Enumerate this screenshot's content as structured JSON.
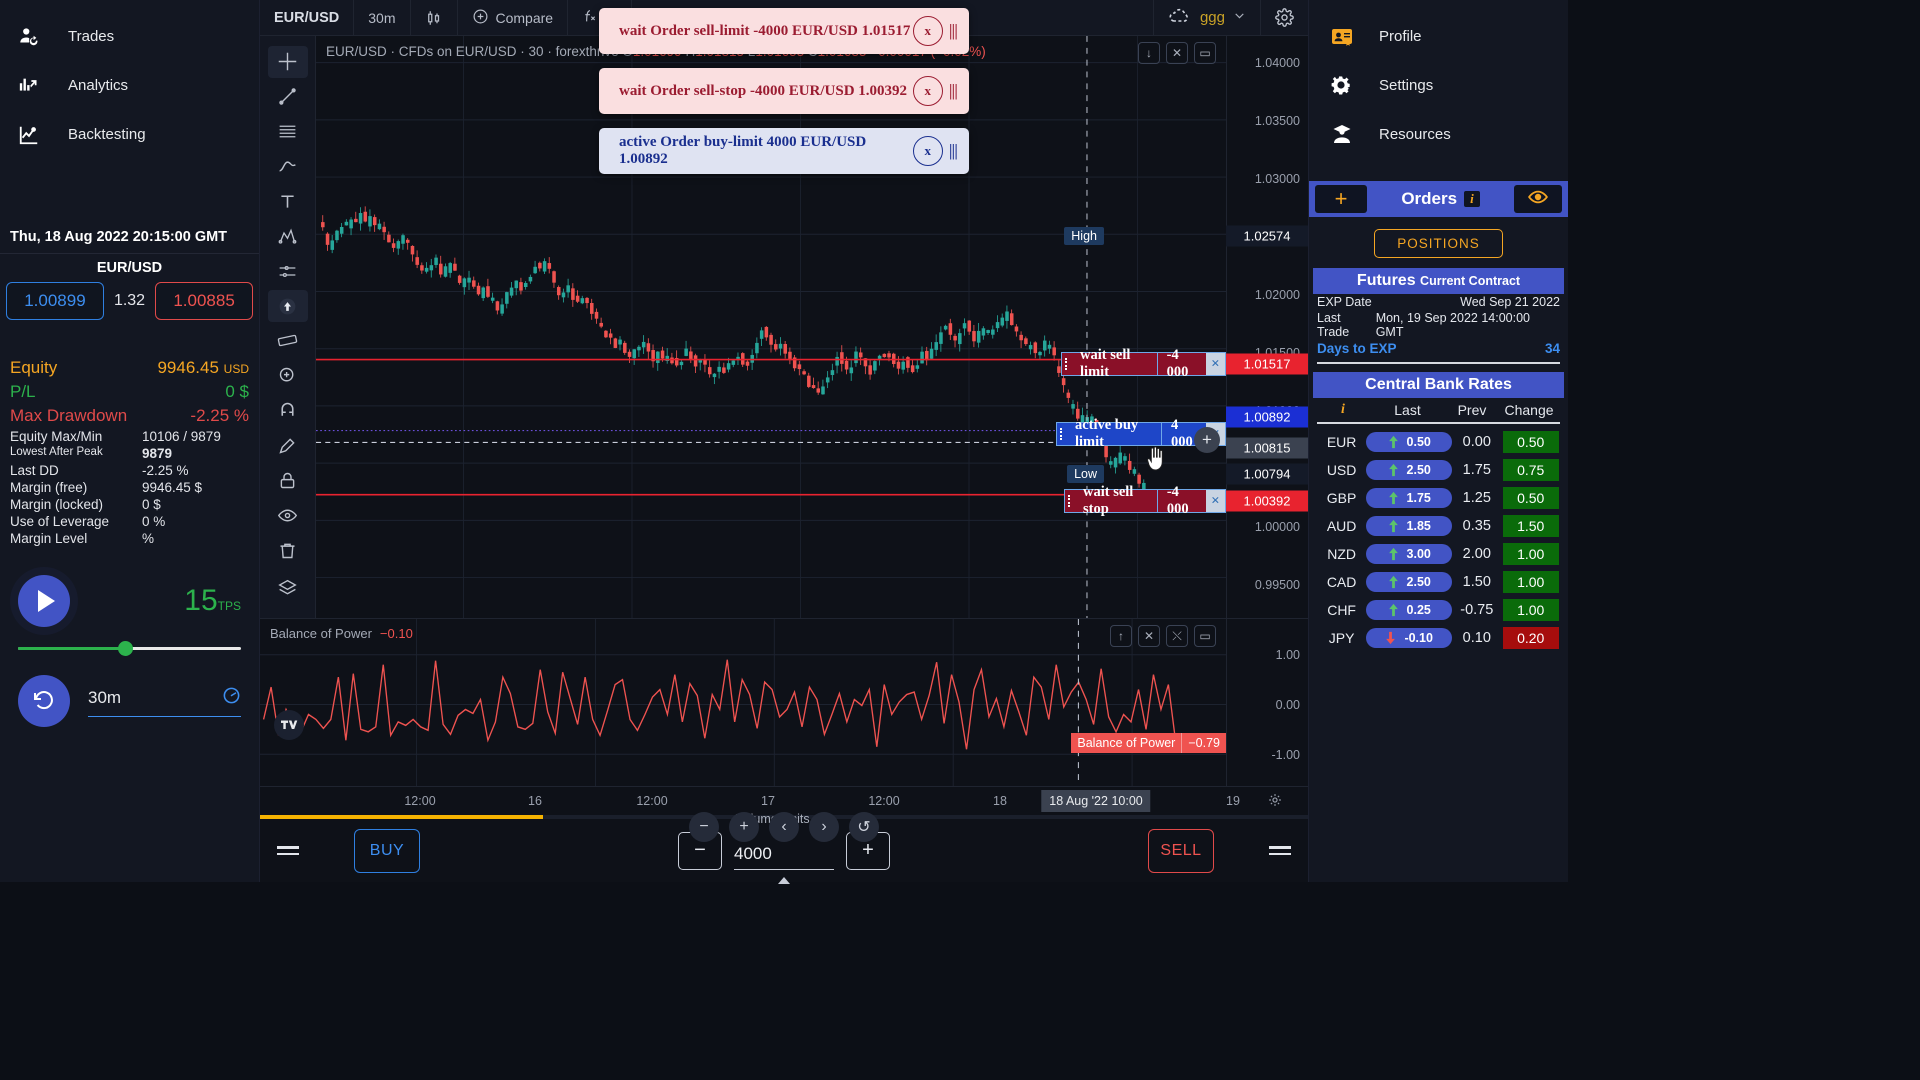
{
  "left_nav": [
    {
      "label": "Trades",
      "icon": "person-refresh-icon"
    },
    {
      "label": "Analytics",
      "icon": "analytics-bars-icon"
    },
    {
      "label": "Backtesting",
      "icon": "line-chart-icon"
    }
  ],
  "session": {
    "datetime": "Thu, 18 Aug 2022 20:15:00 GMT",
    "symbol": "EUR/USD",
    "bid": "1.00899",
    "spread": "1.32",
    "ask": "1.00885"
  },
  "stats": {
    "equity_label": "Equity",
    "equity_value": "9946.45",
    "equity_unit": "USD",
    "pl_label": "P/L",
    "pl_value": "0 $",
    "dd_label": "Max Drawdown",
    "dd_value": "-2.25 %",
    "rows": [
      {
        "k": "Equity Max/Min",
        "v": "10106 / 9879",
        "small": false
      },
      {
        "k": "Lowest After Peak",
        "v": "9879",
        "small": true
      },
      {
        "k": "Last DD",
        "v": "-2.25 %",
        "small": false
      },
      {
        "k": "Margin (free)",
        "v": "9946.45 $",
        "small": false
      },
      {
        "k": "Margin (locked)",
        "v": "0 $",
        "small": false
      },
      {
        "k": "Use of Leverage",
        "v": "0 %",
        "small": false
      },
      {
        "k": "Margin Level",
        "v": "%",
        "small": false
      }
    ]
  },
  "playback": {
    "tps_value": "15",
    "tps_unit": "TPS",
    "timeframe": "30m"
  },
  "toolbar": {
    "symbol": "EUR/USD",
    "interval": "30m",
    "candles_icon": "candlestick-icon",
    "compare": "Compare",
    "indicators": "In",
    "user": "ggg"
  },
  "chart": {
    "legend_symbol": "EUR/USD",
    "legend_desc": "CFDs on EUR/USD",
    "legend_interval": "30",
    "legend_source": "forexthrive",
    "o_label": "O",
    "o": "1.01699",
    "h_label": "H",
    "h": "1.01815",
    "l_label": "L",
    "l": "1.01653",
    "c_label": "C",
    "c": "1.01683",
    "change": "−0.00017 (−0.02%)",
    "price_ticks": [
      "1.04000",
      "1.03500",
      "1.03000",
      "1.02500",
      "1.02000",
      "1.01500",
      "1.01000",
      "1.00500",
      "1.00000",
      "0.99500"
    ],
    "high_tag": "High",
    "high_value": "1.02574",
    "low_tag": "Low",
    "low_value": "1.00794",
    "badges": [
      {
        "text": "1.01517",
        "kind": "red"
      },
      {
        "text": "1.00892",
        "kind": "blue"
      },
      {
        "text": "1.00815",
        "kind": "grey"
      },
      {
        "text": "1.00392",
        "kind": "red"
      }
    ],
    "orders": [
      {
        "name": "wait sell limit",
        "qty": "-4 000",
        "kind": "red",
        "close": "×"
      },
      {
        "name": "active buy limit",
        "qty": "4 000",
        "kind": "blue",
        "close": "×"
      },
      {
        "name": "wait sell stop",
        "qty": "-4 000",
        "kind": "red",
        "close": "×"
      }
    ],
    "time_ticks": [
      "12:00",
      "16",
      "12:00",
      "17",
      "12:00",
      "18",
      "19"
    ],
    "cursor_time": "18 Aug '22  10:00"
  },
  "indicator": {
    "name": "Balance of Power",
    "value": "−0.10",
    "scale": [
      "1.00",
      "0.00",
      "-1.00"
    ],
    "tag_name": "Balance of Power",
    "tag_value": "−0.79"
  },
  "bottom": {
    "buy": "BUY",
    "sell": "SELL",
    "volume_label": "Volume Units",
    "volume_value": "4000",
    "minus": "−",
    "plus": "+"
  },
  "toasts": [
    {
      "text": "wait Order sell-limit -4000 EUR/USD 1.01517",
      "kind": "err",
      "close": "x"
    },
    {
      "text": "wait Order sell-stop -4000 EUR/USD 1.00392",
      "kind": "err",
      "close": "x"
    },
    {
      "text": "active Order buy-limit 4000 EUR/USD 1.00892",
      "kind": "info",
      "close": "x"
    }
  ],
  "right_nav": [
    {
      "label": "Profile",
      "icon": "profile-card-icon"
    },
    {
      "label": "Settings",
      "icon": "gear-icon"
    },
    {
      "label": "Resources",
      "icon": "graduate-icon"
    }
  ],
  "orders_bar": {
    "add": "+",
    "title": "Orders",
    "info": "i",
    "eye_icon": "eye-icon"
  },
  "positions_button": "POSITIONS",
  "futures": {
    "header": "Futures",
    "header_sub": "Current Contract",
    "exp_date_label": "EXP Date",
    "exp_date_value": "Wed Sep 21 2022",
    "last_trade_label": "Last Trade",
    "last_trade_value": "Mon, 19 Sep 2022 14:00:00 GMT",
    "days_label": "Days to EXP",
    "days_value": "34"
  },
  "central_bank": {
    "title": "Central Bank Rates",
    "columns": {
      "info": "i",
      "last": "Last",
      "prev": "Prev",
      "change": "Change"
    },
    "rows": [
      {
        "cur": "EUR",
        "dir": "up",
        "last": "0.50",
        "prev": "0.00",
        "change": "0.50",
        "change_kind": "up"
      },
      {
        "cur": "USD",
        "dir": "up",
        "last": "2.50",
        "prev": "1.75",
        "change": "0.75",
        "change_kind": "up"
      },
      {
        "cur": "GBP",
        "dir": "up",
        "last": "1.75",
        "prev": "1.25",
        "change": "0.50",
        "change_kind": "up"
      },
      {
        "cur": "AUD",
        "dir": "up",
        "last": "1.85",
        "prev": "0.35",
        "change": "1.50",
        "change_kind": "up"
      },
      {
        "cur": "NZD",
        "dir": "up",
        "last": "3.00",
        "prev": "2.00",
        "change": "1.00",
        "change_kind": "up"
      },
      {
        "cur": "CAD",
        "dir": "up",
        "last": "2.50",
        "prev": "1.50",
        "change": "1.00",
        "change_kind": "up"
      },
      {
        "cur": "CHF",
        "dir": "up",
        "last": "0.25",
        "prev": "-0.75",
        "change": "1.00",
        "change_kind": "up"
      },
      {
        "cur": "JPY",
        "dir": "down",
        "last": "-0.10",
        "prev": "0.10",
        "change": "0.20",
        "change_kind": "down"
      }
    ]
  },
  "chart_data": {
    "type": "line",
    "title": "Balance of Power",
    "ylabel": "",
    "xlabel": "",
    "ylim": [
      -1,
      1
    ],
    "grid": true,
    "legend_position": "top-left",
    "values": [
      -0.3,
      0.35,
      -0.62,
      -0.1,
      -0.42,
      -0.55,
      -0.2,
      -0.3,
      -0.48,
      -0.3,
      0.55,
      -0.72,
      0.62,
      -0.5,
      -0.55,
      -0.45,
      0.8,
      -0.62,
      -0.35,
      -0.42,
      -0.3,
      -0.45,
      -0.52,
      0.88,
      -0.4,
      -0.6,
      -0.22,
      -0.1,
      -0.18,
      0.1,
      -0.72,
      -0.35,
      0.55,
      0.22,
      -0.45,
      -0.5,
      -0.38,
      0.7,
      -0.15,
      -0.58,
      0.65,
      0.12,
      -0.4,
      0.55,
      -0.3,
      -0.62,
      -0.12,
      0.4,
      0.5,
      -0.3,
      -0.52,
      -0.2,
      0.15,
      0.3,
      -0.2,
      0.6,
      -0.35,
      0.42,
      0.18,
      -0.68,
      0.2,
      -0.1,
      0.9,
      -0.35,
      0.5,
      0.2,
      -0.48,
      0.45,
      0.3,
      -0.25,
      -0.1,
      0.25,
      -0.45,
      0.35,
      0.1,
      -0.6,
      -0.2,
      0.22,
      -0.35,
      0.1,
      -0.02,
      0.3,
      -0.85,
      0.4,
      -0.2,
      0.05,
      0.2,
      0.25,
      -0.3,
      0.18,
      0.85,
      -0.38,
      0.6,
      0.05,
      -0.9,
      0.3,
      0.7,
      -0.25,
      0.12,
      -0.45,
      0.28,
      -0.15,
      -0.62,
      0.55,
      0.35,
      -0.3,
      0.8,
      -0.05,
      0.25,
      0.45,
      0.1,
      -0.4,
      0.72,
      -0.25,
      -0.55,
      -0.2,
      -0.35,
      0.3,
      -0.5,
      0.6,
      -0.1,
      0.4,
      -0.79
    ]
  }
}
